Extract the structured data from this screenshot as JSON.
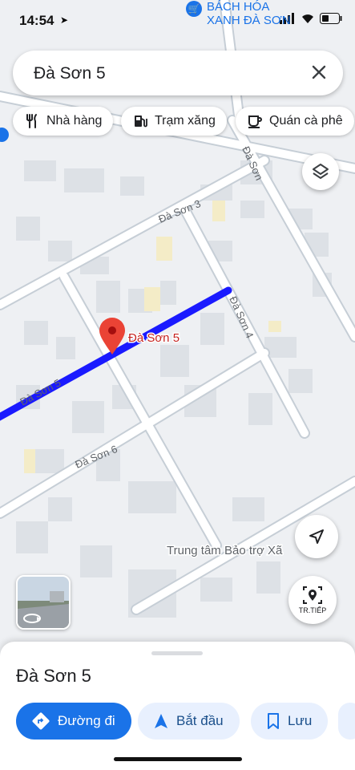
{
  "status_bar": {
    "time": "14:54"
  },
  "poi_top": {
    "line1": "BÁCH HÓA",
    "line2": "XANH ĐÀ SƠN"
  },
  "search": {
    "query": "Đà Sơn 5"
  },
  "chips": [
    {
      "label": "Nhà hàng",
      "icon": "fork-knife-icon"
    },
    {
      "label": "Trạm xăng",
      "icon": "gas-station-icon"
    },
    {
      "label": "Quán cà phê",
      "icon": "coffee-cup-icon"
    }
  ],
  "map": {
    "roads": {
      "da_son_3": "Đà Sơn 3",
      "da_son": "Đà Sơn",
      "da_son_4": "Đà Sơn 4",
      "da_son_5": "Đà Sơn 5",
      "da_son_6": "Đà Sơn 6"
    },
    "pin_label": "Đà Sơn 5",
    "poi_bottom": "Trung tâm Bảo trợ Xã",
    "route_color": "#1a1aff",
    "pin_color": "#ea4335"
  },
  "buttons": {
    "next_label": "TR.TIẾP"
  },
  "sheet": {
    "title": "Đà Sơn 5",
    "directions": "Đường đi",
    "start": "Bắt đầu",
    "save": "Lưu"
  }
}
